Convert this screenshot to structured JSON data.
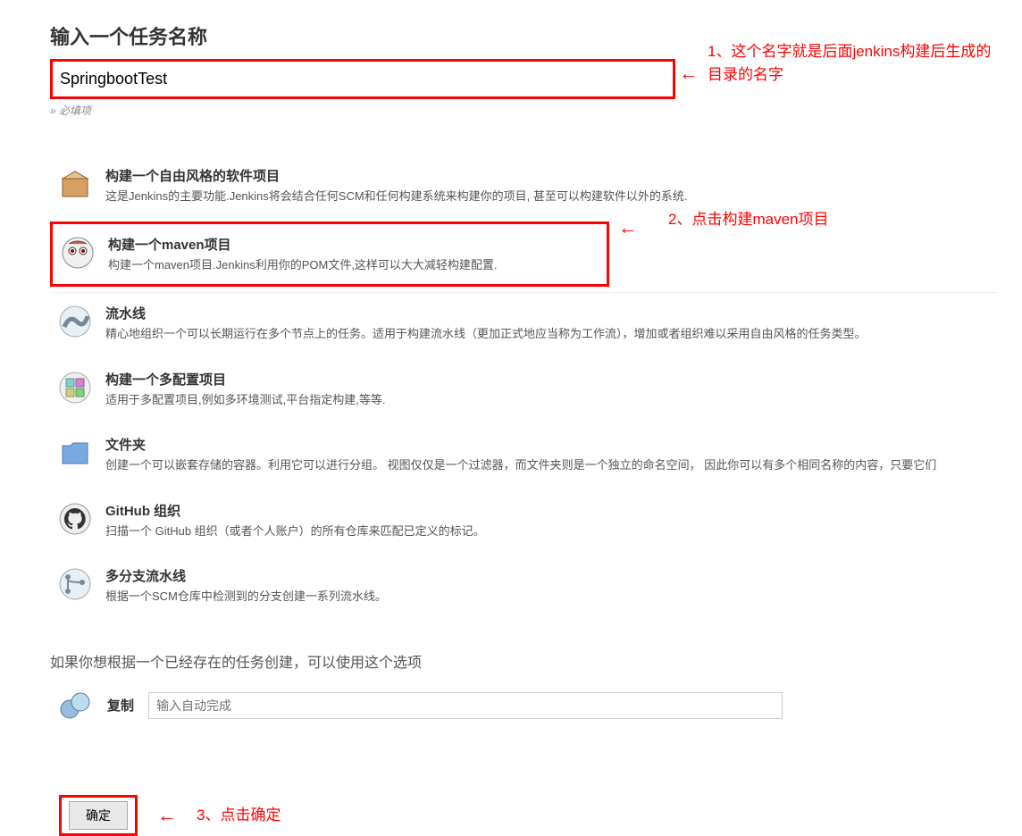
{
  "page": {
    "title": "输入一个任务名称",
    "item_name_value": "SpringbootTest",
    "required_note": "» 必填项"
  },
  "annotations": {
    "a1": "1、这个名字就是后面jenkins构建后生成的目录的名字",
    "a2": "2、点击构建maven项目",
    "a3": "3、点击确定",
    "arrow": "←"
  },
  "categories": [
    {
      "id": "freestyle",
      "title": "构建一个自由风格的软件项目",
      "desc": "这是Jenkins的主要功能.Jenkins将会结合任何SCM和任何构建系统来构建你的项目, 甚至可以构建软件以外的系统.",
      "icon": "box-icon",
      "selected": false
    },
    {
      "id": "maven",
      "title": "构建一个maven项目",
      "desc": "构建一个maven项目.Jenkins利用你的POM文件,这样可以大大减轻构建配置.",
      "icon": "maven-icon",
      "selected": true
    },
    {
      "id": "pipeline",
      "title": "流水线",
      "desc": "精心地组织一个可以长期运行在多个节点上的任务。适用于构建流水线（更加正式地应当称为工作流），增加或者组织难以采用自由风格的任务类型。",
      "icon": "pipeline-icon",
      "selected": false
    },
    {
      "id": "multiconfig",
      "title": "构建一个多配置项目",
      "desc": "适用于多配置项目,例如多环境测试,平台指定构建,等等.",
      "icon": "multiconfig-icon",
      "selected": false
    },
    {
      "id": "folder",
      "title": "文件夹",
      "desc": "创建一个可以嵌套存储的容器。利用它可以进行分组。 视图仅仅是一个过滤器，而文件夹则是一个独立的命名空间， 因此你可以有多个相同名称的内容，只要它们",
      "icon": "folder-icon",
      "selected": false
    },
    {
      "id": "github-org",
      "title": "GitHub 组织",
      "desc": "扫描一个 GitHub 组织（或者个人账户）的所有仓库来匹配已定义的标记。",
      "icon": "github-icon",
      "selected": false
    },
    {
      "id": "multibranch",
      "title": "多分支流水线",
      "desc": "根据一个SCM仓库中检测到的分支创建一系列流水线。",
      "icon": "branch-icon",
      "selected": false
    }
  ],
  "copy": {
    "hint": "如果你想根据一个已经存在的任务创建，可以使用这个选项",
    "label": "复制",
    "placeholder": "输入自动完成"
  },
  "ok": {
    "label": "确定"
  }
}
